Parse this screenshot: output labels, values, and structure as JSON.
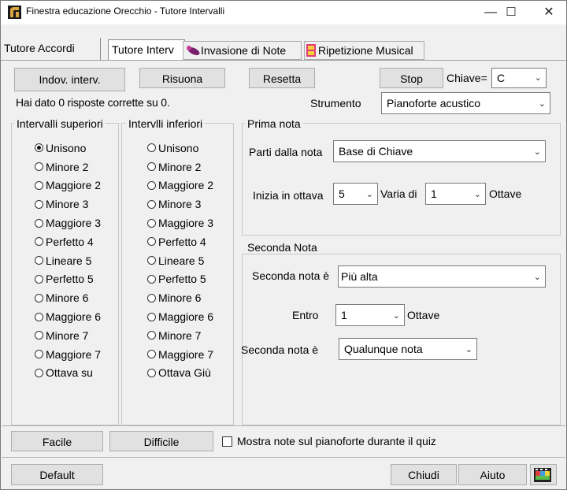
{
  "window": {
    "title": "Finestra educazione Orecchio - Tutore Intervalli",
    "minimize": "—",
    "maximize": "☐",
    "close": "✕"
  },
  "tabs": [
    {
      "label": "Tutore Accordi"
    },
    {
      "label": "Tutore Interv"
    },
    {
      "label": "Invasione di Note"
    },
    {
      "label": "Ripetizione Musical"
    }
  ],
  "toolbar": {
    "guess_label": "Indov. interv.",
    "replay_label": "Risuona",
    "reset_label": "Resetta",
    "stop_label": "Stop",
    "key_label": "Chiave=",
    "key_value": "C"
  },
  "status": {
    "text": "Hai dato 0 risposte corrette su 0.",
    "instrument_label": "Strumento",
    "instrument_value": "Pianoforte acustico"
  },
  "upper_intervals": {
    "title": "Intervalli superiori",
    "options": [
      "Unisono",
      "Minore 2",
      "Maggiore 2",
      "Minore 3",
      "Maggiore 3",
      "Perfetto 4",
      "Lineare 5",
      "Perfetto 5",
      "Minore 6",
      "Maggiore 6",
      "Minore 7",
      "Maggiore 7",
      "Ottava su"
    ],
    "selected_index": 0
  },
  "lower_intervals": {
    "title": "Intervlli inferiori",
    "options": [
      "Unisono",
      "Minore 2",
      "Maggiore 2",
      "Minore 3",
      "Maggiore 3",
      "Perfetto 4",
      "Lineare 5",
      "Perfetto 5",
      "Minore 6",
      "Maggiore 6",
      "Minore 7",
      "Maggiore 7",
      "Ottava Giù"
    ],
    "selected_index": -1
  },
  "first_note": {
    "title": "Prima nota",
    "start_label": "Parti dalla nota",
    "start_value": "Base di Chiave",
    "octave_label": "Inizia in ottava",
    "octave_value": "5",
    "vary_label": "Varia di",
    "vary_value": "1",
    "octaves_label": "Ottave"
  },
  "second_note": {
    "title": "Seconda Nota",
    "direction_label": "Seconda nota è",
    "direction_value": "Più alta",
    "within_label": "Entro",
    "within_value": "1",
    "octaves_label": "Ottave",
    "type_label": "Seconda nota è",
    "type_value": "Qualunque nota"
  },
  "bottom": {
    "easy_label": "Facile",
    "hard_label": "Difficile",
    "show_piano_label": "Mostra note sul pianoforte durante il quiz",
    "show_piano_checked": false,
    "default_label": "Default",
    "close_label": "Chiudi",
    "help_label": "Aiuto"
  },
  "colors": {
    "dialog_bg": "#f0f0f0",
    "button_bg": "#e1e1e1",
    "border": "#adadad"
  }
}
